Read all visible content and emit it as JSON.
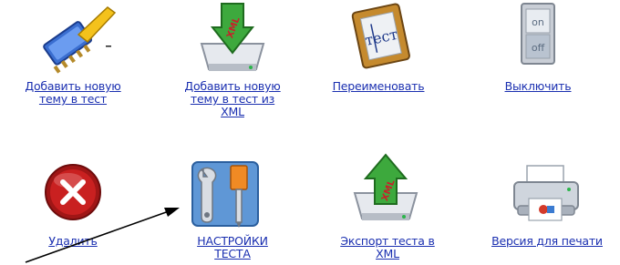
{
  "items": [
    {
      "lines": [
        "Добавить новую",
        "тему в тест"
      ],
      "icon": "add-topic-icon"
    },
    {
      "lines": [
        "Добавить новую",
        "тему в тест из",
        "XML"
      ],
      "icon": "xml-import-icon",
      "badge": "XML"
    },
    {
      "lines": [
        "Переименовать"
      ],
      "icon": "rename-icon",
      "badge": "тест"
    },
    {
      "lines": [
        "Выключить"
      ],
      "icon": "on-off-switch-icon",
      "on": "on",
      "off": "off"
    },
    {
      "lines": [
        "Удалить"
      ],
      "icon": "delete-icon"
    },
    {
      "lines": [
        "НАСТРОЙКИ",
        "ТЕСТА"
      ],
      "icon": "settings-tools-icon"
    },
    {
      "lines": [
        "Экспорт теста в",
        "XML"
      ],
      "icon": "xml-export-icon",
      "badge": "XML"
    },
    {
      "lines": [
        "Версия для печати"
      ],
      "icon": "printer-icon"
    }
  ]
}
